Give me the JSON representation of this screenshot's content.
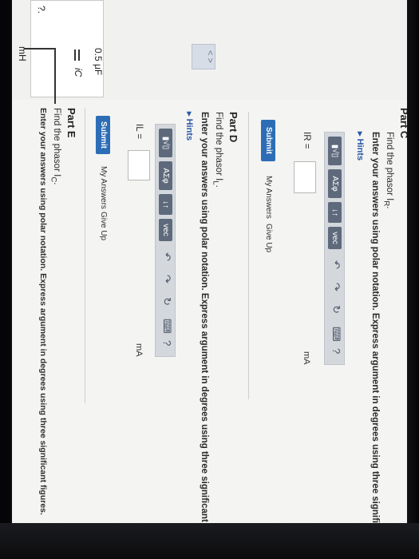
{
  "header": {
    "section_label": "Part C"
  },
  "figure": {
    "partial_label": "?.",
    "inductor_label": "mH",
    "capacitor_label": "0.5 μF",
    "current_label": "iC",
    "nav_label": "< >"
  },
  "part_c": {
    "prompt": "Find the phasor I",
    "prompt_sub": "R",
    "instruction": "Enter your answers using polar notation. Express argument in degrees using three significant figures.",
    "hints_label": "▸ Hints",
    "answer_label": "IR =",
    "unit": "mA",
    "submit_label": "Submit",
    "my_answers_label": "My Answers",
    "give_up_label": "Give Up"
  },
  "part_d": {
    "title": "Part D",
    "prompt": "Find the phasor I",
    "prompt_sub": "L",
    "instruction": "Enter your answers using polar notation. Express argument in degrees using three significant figures.",
    "hints_label": "▸ Hints",
    "answer_label": "IL =",
    "unit": "mA",
    "submit_label": "Submit",
    "my_answers_label": "My Answers",
    "give_up_label": "Give Up"
  },
  "part_e": {
    "title": "Part E",
    "prompt": "Find the phasor I",
    "prompt_sub": "C",
    "instruction": "Enter your answers using polar notation. Express argument in degrees using three significant figures."
  },
  "toolbar": {
    "templates_label": "▮√▯",
    "greek_label": "ΑΣφ",
    "arrows_label": "↓↑",
    "vec_label": "vec",
    "undo_icon": "↶",
    "redo_icon": "↷",
    "reset_icon": "↻",
    "keyboard_icon": "⌨",
    "help_icon": "?"
  }
}
